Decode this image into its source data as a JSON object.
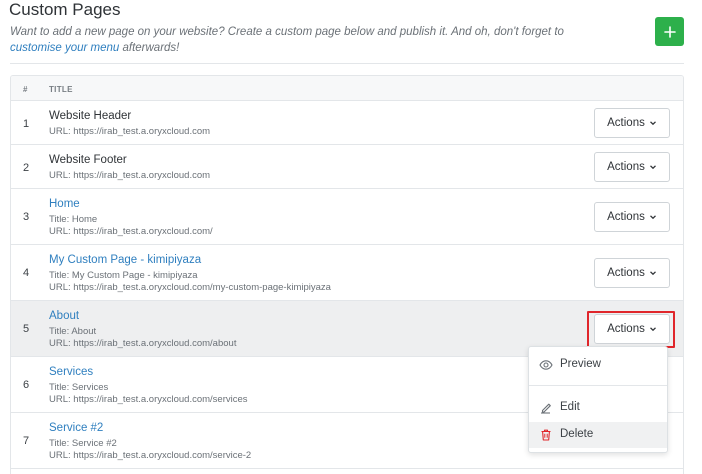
{
  "page": {
    "title": "Custom Pages",
    "subtitle_text": "Want to add a new page on your website? Create a custom page below and publish it. And oh, don't forget to",
    "subtitle_link": "customise your menu",
    "subtitle_tail": " afterwards!",
    "add_button_icon": "plus-icon"
  },
  "table": {
    "columns": [
      "#",
      "TITLE"
    ],
    "rows": [
      {
        "num": "1",
        "title": "Website Header",
        "is_link": false,
        "meta_title": "",
        "meta_url": "URL:  https://irab_test.a.oryxcloud.com",
        "actions_label": "Actions"
      },
      {
        "num": "2",
        "title": "Website Footer",
        "is_link": false,
        "meta_title": "",
        "meta_url": "URL:  https://irab_test.a.oryxcloud.com",
        "actions_label": "Actions"
      },
      {
        "num": "3",
        "title": "Home",
        "is_link": true,
        "meta_title": "Title:  Home",
        "meta_url": "URL:  https://irab_test.a.oryxcloud.com/",
        "actions_label": "Actions"
      },
      {
        "num": "4",
        "title": "My Custom Page - kimipiyaza",
        "is_link": true,
        "meta_title": "Title:  My Custom Page - kimipiyaza",
        "meta_url": "URL:  https://irab_test.a.oryxcloud.com/my-custom-page-kimipiyaza",
        "actions_label": "Actions"
      },
      {
        "num": "5",
        "title": "About",
        "is_link": true,
        "meta_title": "Title:  About",
        "meta_url": "URL:  https://irab_test.a.oryxcloud.com/about",
        "actions_label": "Actions"
      },
      {
        "num": "6",
        "title": "Services",
        "is_link": true,
        "meta_title": "Title:  Services",
        "meta_url": "URL:  https://irab_test.a.oryxcloud.com/services",
        "actions_label": ""
      },
      {
        "num": "7",
        "title": "Service #2",
        "is_link": true,
        "meta_title": "Title:  Service #2",
        "meta_url": "URL:  https://irab_test.a.oryxcloud.com/service-2",
        "actions_label": ""
      }
    ]
  },
  "dropdown": {
    "items": [
      {
        "label": "Preview",
        "icon": "eye-icon"
      },
      {
        "label": "Edit",
        "icon": "edit-icon"
      },
      {
        "label": "Delete",
        "icon": "trash-icon",
        "color": "#e0262b"
      }
    ]
  },
  "colors": {
    "accent_green": "#2db04b",
    "link_blue": "#2f7fbf",
    "highlight_red": "#e0262b"
  }
}
